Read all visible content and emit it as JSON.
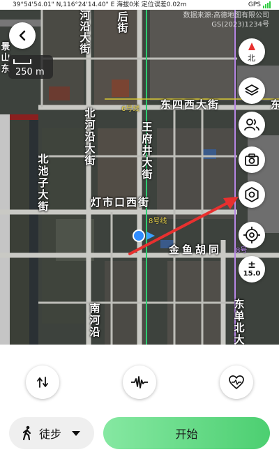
{
  "status_bar": {
    "location_text": "39°54'54.01\" N,116°24'14.40\" E 海拔0米 定位误差0.02m",
    "gps_label": "GPS",
    "signal_color": "#2ecc40"
  },
  "map": {
    "attribution_line1": "数据来源:高德地图有限公司",
    "attribution_line2": "GS(2023)1234号",
    "scale_label": "250 m",
    "labels": {
      "houjie": "后街",
      "heyan_top": "河沿大街",
      "dongsixi": "东四西大街",
      "donghe_edge": "东",
      "beiheyan": "北河沿大街",
      "wangfujing": "王府井大街",
      "beichizi": "北池子大街",
      "dengshikou": "灯市口西街",
      "jinyuhutong": "金鱼胡同",
      "nanheyan": "南河沿",
      "dongdan": "东单北大街",
      "jingshan_edge": "景山东"
    },
    "metro": {
      "line6": "6号线",
      "line8": "8号线",
      "line8b": "8号"
    },
    "route_color": "#e8302f",
    "location_dot_color": "#2f8cff",
    "compass_needle_color": "#e8302f"
  },
  "controls": {
    "compass_label": "北",
    "zoom_sign": "±",
    "zoom_level": "15.0"
  },
  "panel": {
    "mode_label": "徒步",
    "start_label": "开始",
    "start_gradient": [
      "#86e8a2",
      "#4ccf71"
    ]
  }
}
